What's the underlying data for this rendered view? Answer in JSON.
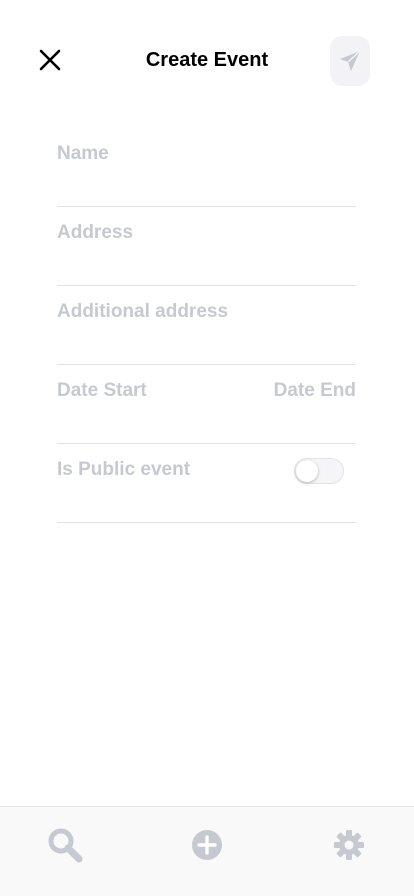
{
  "header": {
    "title": "Create Event",
    "close_icon": "close-icon",
    "send_icon": "paper-plane-icon"
  },
  "form": {
    "name_placeholder": "Name",
    "address_placeholder": "Address",
    "additional_address_placeholder": "Additional address",
    "date_start_placeholder": "Date Start",
    "date_end_placeholder": "Date End",
    "public_label": "Is Public event",
    "public_value": false
  },
  "tabbar": {
    "items": [
      {
        "icon": "search-icon"
      },
      {
        "icon": "plus-circle-icon"
      },
      {
        "icon": "gear-icon"
      }
    ]
  },
  "colors": {
    "placeholder": "#c7c9d1",
    "icon_gray": "#c7c9d1",
    "divider": "#e2e2e6",
    "title": "#000000"
  }
}
